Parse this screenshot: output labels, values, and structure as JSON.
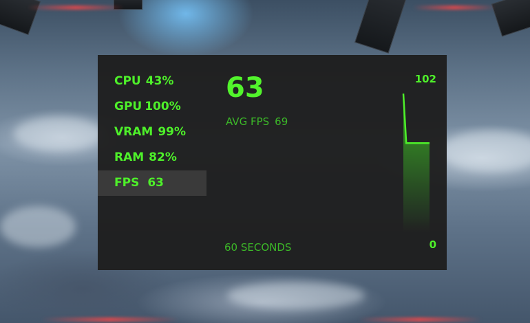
{
  "overlay": {
    "stats": [
      {
        "label": "CPU",
        "value": "43%"
      },
      {
        "label": "GPU",
        "value": "100%"
      },
      {
        "label": "VRAM",
        "value": "99%"
      },
      {
        "label": "RAM",
        "value": "82%"
      },
      {
        "label": "FPS",
        "value": "63"
      }
    ],
    "selected_stat": "FPS",
    "current_fps": "63",
    "avg_fps_label": "AVG FPS",
    "avg_fps_value": "69",
    "graph_window_label": "60 SECONDS",
    "graph_max_label": "102",
    "graph_min_label": "0",
    "colors": {
      "accent_green": "#4ef02a",
      "dim_green": "#3cb828",
      "panel_bg": "#1e1e1e",
      "selected_row_bg": "#3a3a3a"
    }
  },
  "chart_data": {
    "type": "area",
    "series": [
      {
        "values": [
          98,
          63,
          63,
          63,
          63,
          63,
          63,
          63,
          63,
          63
        ]
      }
    ],
    "ylim": [
      0,
      102
    ],
    "grid": false
  }
}
